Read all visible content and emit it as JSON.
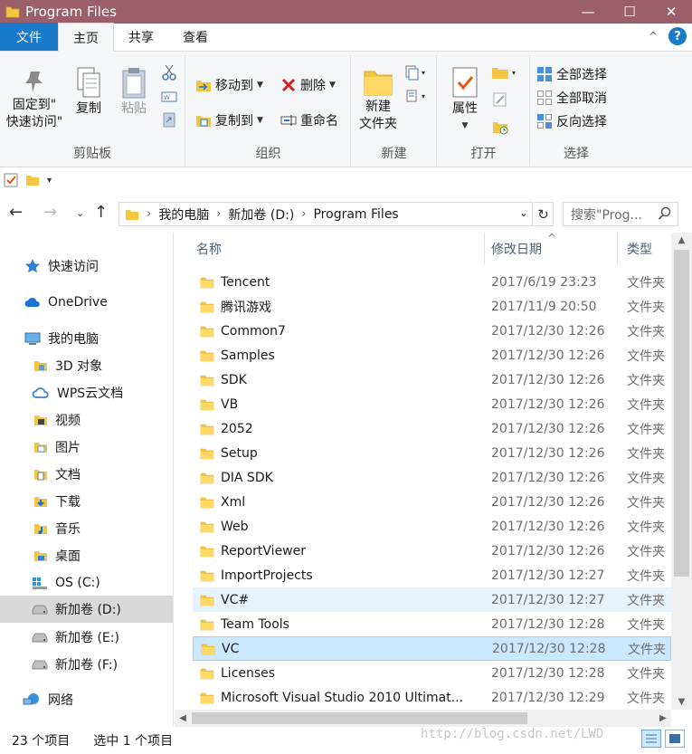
{
  "window": {
    "title": "Program Files",
    "minimize_glyph": "—",
    "maximize_glyph": "☐",
    "close_glyph": "✕"
  },
  "tabs": [
    {
      "label": "文件"
    },
    {
      "label": "主页"
    },
    {
      "label": "共享"
    },
    {
      "label": "查看"
    }
  ],
  "tabs_right": {
    "collapse_glyph": "^",
    "help_glyph": "?"
  },
  "ribbon": {
    "clipboard": {
      "label": "剪贴板",
      "pin_line1": "固定到\"",
      "pin_line2": "快速访问\"",
      "copy": "复制",
      "paste": "粘贴"
    },
    "organize": {
      "label": "组织",
      "move_to": "移动到",
      "copy_to": "复制到",
      "delete": "删除",
      "rename": "重命名"
    },
    "new": {
      "label": "新建",
      "new_folder_line1": "新建",
      "new_folder_line2": "文件夹"
    },
    "open": {
      "label": "打开",
      "properties": "属性"
    },
    "select": {
      "label": "选择",
      "select_all": "全部选择",
      "select_none": "全部取消",
      "invert": "反向选择"
    }
  },
  "address": {
    "crumbs": [
      "我的电脑",
      "新加卷 (D:)",
      "Program Files"
    ],
    "search_placeholder": "搜索\"Prog..."
  },
  "sidebar": {
    "items": [
      {
        "label": "快速访问",
        "icon": "star-icon"
      },
      {
        "label": "OneDrive",
        "icon": "cloud-icon"
      },
      {
        "label": "我的电脑",
        "icon": "computer-icon"
      },
      {
        "label": "3D 对象",
        "icon": "cube-icon"
      },
      {
        "label": "WPS云文档",
        "icon": "cloud-outline-icon"
      },
      {
        "label": "视频",
        "icon": "video-icon"
      },
      {
        "label": "图片",
        "icon": "picture-icon"
      },
      {
        "label": "文档",
        "icon": "document-icon"
      },
      {
        "label": "下载",
        "icon": "download-icon"
      },
      {
        "label": "音乐",
        "icon": "music-icon"
      },
      {
        "label": "桌面",
        "icon": "desktop-icon"
      },
      {
        "label": "OS (C:)",
        "icon": "windows-drive-icon"
      },
      {
        "label": "新加卷 (D:)",
        "icon": "drive-icon"
      },
      {
        "label": "新加卷 (E:)",
        "icon": "drive-icon"
      },
      {
        "label": "新加卷 (F:)",
        "icon": "drive-icon"
      },
      {
        "label": "网络",
        "icon": "network-icon"
      }
    ]
  },
  "columns": {
    "name": "名称",
    "date": "修改日期",
    "type": "类型"
  },
  "files": [
    {
      "name": "Tencent",
      "date": "2017/6/19 23:23",
      "type": "文件夹"
    },
    {
      "name": "腾讯游戏",
      "date": "2017/11/9 20:50",
      "type": "文件夹"
    },
    {
      "name": "Common7",
      "date": "2017/12/30 12:26",
      "type": "文件夹"
    },
    {
      "name": "Samples",
      "date": "2017/12/30 12:26",
      "type": "文件夹"
    },
    {
      "name": "SDK",
      "date": "2017/12/30 12:26",
      "type": "文件夹"
    },
    {
      "name": "VB",
      "date": "2017/12/30 12:26",
      "type": "文件夹"
    },
    {
      "name": "2052",
      "date": "2017/12/30 12:26",
      "type": "文件夹"
    },
    {
      "name": "Setup",
      "date": "2017/12/30 12:26",
      "type": "文件夹"
    },
    {
      "name": "DIA SDK",
      "date": "2017/12/30 12:26",
      "type": "文件夹"
    },
    {
      "name": "Xml",
      "date": "2017/12/30 12:26",
      "type": "文件夹"
    },
    {
      "name": "Web",
      "date": "2017/12/30 12:26",
      "type": "文件夹"
    },
    {
      "name": "ReportViewer",
      "date": "2017/12/30 12:26",
      "type": "文件夹"
    },
    {
      "name": "ImportProjects",
      "date": "2017/12/30 12:27",
      "type": "文件夹"
    },
    {
      "name": "VC#",
      "date": "2017/12/30 12:27",
      "type": "文件夹"
    },
    {
      "name": "Team Tools",
      "date": "2017/12/30 12:28",
      "type": "文件夹"
    },
    {
      "name": "VC",
      "date": "2017/12/30 12:28",
      "type": "文件夹"
    },
    {
      "name": "Licenses",
      "date": "2017/12/30 12:28",
      "type": "文件夹"
    },
    {
      "name": "Microsoft Visual Studio 2010 Ultimat...",
      "date": "2017/12/30 12:29",
      "type": "文件夹"
    }
  ],
  "status": {
    "count": "23 个项目",
    "selection": "选中 1 个项目",
    "watermark": "http://blog.csdn.net/LWD"
  },
  "colors": {
    "titlebar": "#9a5f6b",
    "file_tab": "#1979ca",
    "folder_yellow": "#f4c542",
    "selection": "#cce8ff"
  }
}
